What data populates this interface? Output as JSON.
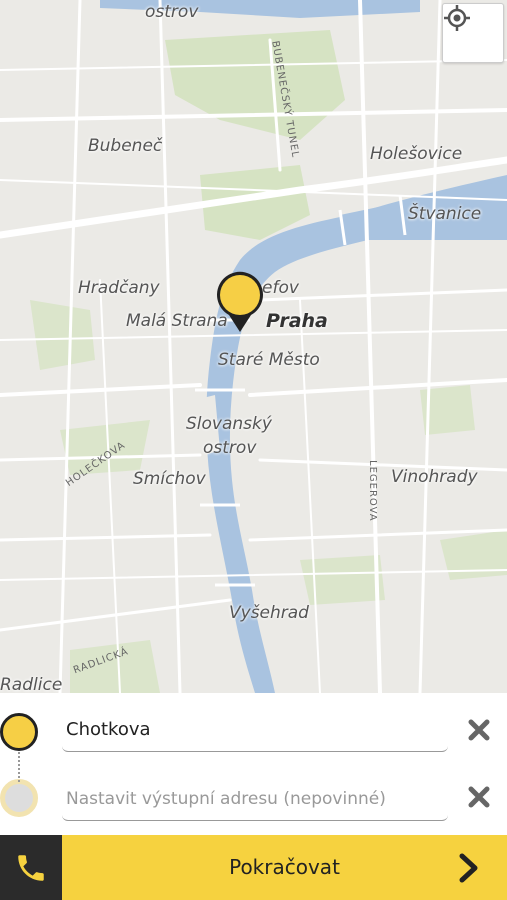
{
  "map": {
    "labels": {
      "ostrov_top": "ostrov",
      "bubenec": "Bubeneč",
      "holesovice": "Holešovice",
      "stvanice": "Štvanice",
      "hradcany": "Hradčany",
      "josefov": "efov",
      "mala_strana": "Malá Strana",
      "praha": "Praha",
      "stare_mesto": "Staré Město",
      "slovansky": "Slovanský",
      "ostrov": "ostrov",
      "smichov": "Smíchov",
      "vinohrady": "Vinohrady",
      "vysehrad": "Vyšehrad",
      "radlice": "Radlice",
      "bubenecsky_tunel": "BUBENEČSKÝ TUNEL",
      "holeckova": "HOLEČKOVA",
      "legerova": "LEGEROVA",
      "radlicka": "RADLICKÁ"
    },
    "locate_icon": "crosshair-icon",
    "pin_color": "#f6cf45"
  },
  "route": {
    "pickup": {
      "value": "Chotkova"
    },
    "destination": {
      "placeholder": "Nastavit výstupní adresu (nepovinné)"
    }
  },
  "footer": {
    "call_icon": "phone-icon",
    "continue_label": "Pokračovat",
    "accent": "#f6d23f"
  }
}
